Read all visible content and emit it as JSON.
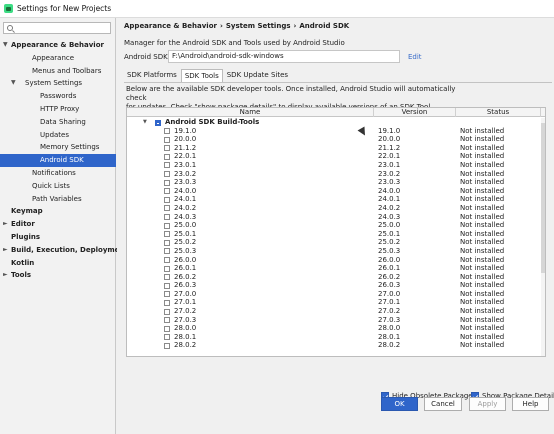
{
  "window": {
    "title": "Settings for New Projects",
    "icon": "android-studio-icon"
  },
  "sidebar": {
    "search_icon": "search-icon",
    "items": [
      {
        "label": "Appearance & Behavior",
        "level": 0,
        "bold": true,
        "arrow": "▼"
      },
      {
        "label": "Appearance",
        "level": 2
      },
      {
        "label": "Menus and Toolbars",
        "level": 2
      },
      {
        "label": "System Settings",
        "level": 1,
        "arrow": "▼"
      },
      {
        "label": "Passwords",
        "level": 3
      },
      {
        "label": "HTTP Proxy",
        "level": 3
      },
      {
        "label": "Data Sharing",
        "level": 3
      },
      {
        "label": "Updates",
        "level": 3
      },
      {
        "label": "Memory Settings",
        "level": 3
      },
      {
        "label": "Android SDK",
        "level": 3,
        "selected": true
      },
      {
        "label": "Notifications",
        "level": 2
      },
      {
        "label": "Quick Lists",
        "level": 2
      },
      {
        "label": "Path Variables",
        "level": 2
      },
      {
        "label": "Keymap",
        "level": 0,
        "bold": true
      },
      {
        "label": "Editor",
        "level": 0,
        "bold": true,
        "arrow": "►"
      },
      {
        "label": "Plugins",
        "level": 0,
        "bold": true
      },
      {
        "label": "Build, Execution, Deployment",
        "level": 0,
        "bold": true,
        "arrow": "►"
      },
      {
        "label": "Kotlin",
        "level": 0,
        "bold": true
      },
      {
        "label": "Tools",
        "level": 0,
        "bold": true,
        "arrow": "►"
      }
    ]
  },
  "main": {
    "breadcrumb": [
      "Appearance & Behavior",
      "System Settings",
      "Android SDK"
    ],
    "breadcrumb_sep": "›",
    "description": "Manager for the Android SDK and Tools used by Android Studio",
    "location_label": "Android SDK Location:",
    "location_value": "F:\\Android\\android-sdk-windows",
    "edit_label": "Edit",
    "tabs": [
      {
        "label": "SDK Platforms",
        "active": false
      },
      {
        "label": "SDK Tools",
        "active": true
      },
      {
        "label": "SDK Update Sites",
        "active": false
      }
    ],
    "info_line1": "Below are the available SDK developer tools. Once installed, Android Studio will automatically check",
    "info_line2": "for updates. Check \"show package details\" to display available versions of an SDK Tool.",
    "columns": [
      "Name",
      "Version",
      "Status"
    ],
    "group": {
      "name": "Android SDK Build-Tools",
      "expander": "▼"
    },
    "rows": [
      {
        "name": "19.1.0",
        "version": "19.1.0",
        "status": "Not installed"
      },
      {
        "name": "20.0.0",
        "version": "20.0.0",
        "status": "Not installed"
      },
      {
        "name": "21.1.2",
        "version": "21.1.2",
        "status": "Not installed"
      },
      {
        "name": "22.0.1",
        "version": "22.0.1",
        "status": "Not installed"
      },
      {
        "name": "23.0.1",
        "version": "23.0.1",
        "status": "Not installed"
      },
      {
        "name": "23.0.2",
        "version": "23.0.2",
        "status": "Not installed"
      },
      {
        "name": "23.0.3",
        "version": "23.0.3",
        "status": "Not installed"
      },
      {
        "name": "24.0.0",
        "version": "24.0.0",
        "status": "Not installed"
      },
      {
        "name": "24.0.1",
        "version": "24.0.1",
        "status": "Not installed"
      },
      {
        "name": "24.0.2",
        "version": "24.0.2",
        "status": "Not installed"
      },
      {
        "name": "24.0.3",
        "version": "24.0.3",
        "status": "Not installed"
      },
      {
        "name": "25.0.0",
        "version": "25.0.0",
        "status": "Not installed"
      },
      {
        "name": "25.0.1",
        "version": "25.0.1",
        "status": "Not installed"
      },
      {
        "name": "25.0.2",
        "version": "25.0.2",
        "status": "Not installed"
      },
      {
        "name": "25.0.3",
        "version": "25.0.3",
        "status": "Not installed"
      },
      {
        "name": "26.0.0",
        "version": "26.0.0",
        "status": "Not installed"
      },
      {
        "name": "26.0.1",
        "version": "26.0.1",
        "status": "Not installed"
      },
      {
        "name": "26.0.2",
        "version": "26.0.2",
        "status": "Not installed"
      },
      {
        "name": "26.0.3",
        "version": "26.0.3",
        "status": "Not installed"
      },
      {
        "name": "27.0.0",
        "version": "27.0.0",
        "status": "Not installed"
      },
      {
        "name": "27.0.1",
        "version": "27.0.1",
        "status": "Not installed"
      },
      {
        "name": "27.0.2",
        "version": "27.0.2",
        "status": "Not installed"
      },
      {
        "name": "27.0.3",
        "version": "27.0.3",
        "status": "Not installed"
      },
      {
        "name": "28.0.0",
        "version": "28.0.0",
        "status": "Not installed"
      },
      {
        "name": "28.0.1",
        "version": "28.0.1",
        "status": "Not installed"
      },
      {
        "name": "28.0.2",
        "version": "28.0.2",
        "status": "Not installed"
      }
    ],
    "hide_obsolete_label": "Hide Obsolete Packages",
    "show_details_label": "Show Package Details"
  },
  "footer": {
    "ok_label": "OK",
    "cancel_label": "Cancel",
    "apply_label": "Apply",
    "help_label": "Help"
  },
  "colors": {
    "accent": "#2f65ca",
    "link": "#3a6cc9"
  }
}
